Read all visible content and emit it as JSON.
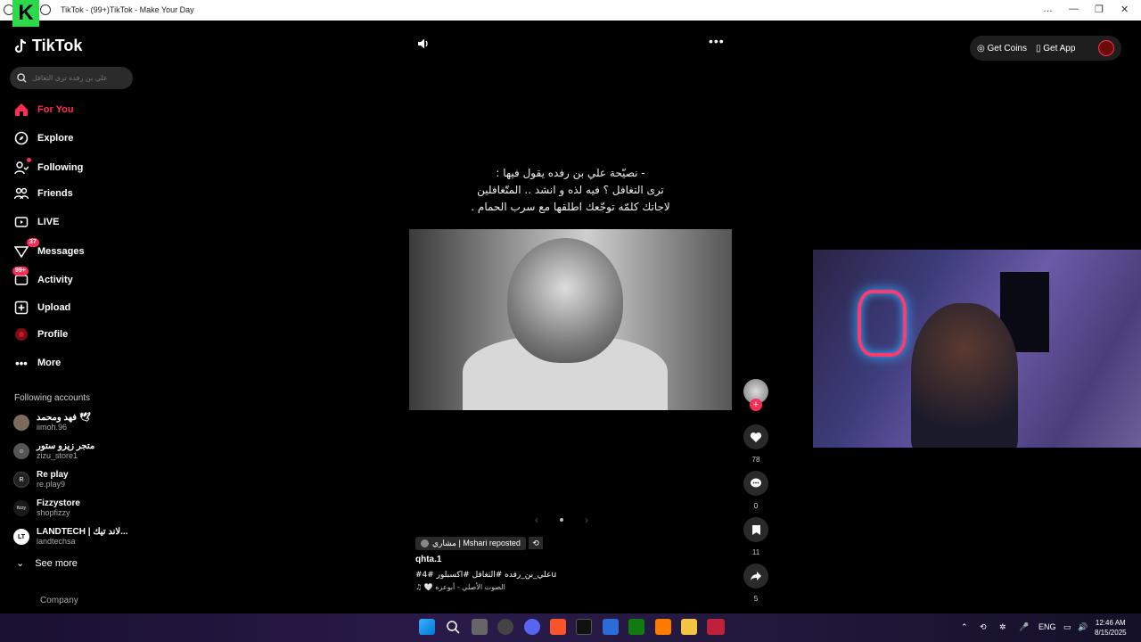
{
  "window": {
    "title": "TikTok - (99+)TikTok - Make Your Day",
    "controls": [
      "…",
      "—",
      "❐",
      "✕"
    ]
  },
  "sidebar": {
    "brand": "TikTok",
    "search_placeholder": "علي بن رفده ترى التغافل",
    "nav": [
      {
        "label": "For You",
        "icon": "home-icon",
        "active": true
      },
      {
        "label": "Explore",
        "icon": "compass-icon"
      },
      {
        "label": "Following",
        "icon": "following-icon"
      },
      {
        "label": "Friends",
        "icon": "friends-icon"
      },
      {
        "label": "LIVE",
        "icon": "live-icon"
      },
      {
        "label": "Messages",
        "icon": "messages-icon",
        "badge": "37"
      },
      {
        "label": "Activity",
        "icon": "activity-icon",
        "badge": "99+"
      },
      {
        "label": "Upload",
        "icon": "upload-icon"
      },
      {
        "label": "Profile",
        "icon": "profile-icon"
      },
      {
        "label": "More",
        "icon": "more-icon"
      }
    ],
    "following_title": "Following accounts",
    "accounts": [
      {
        "name": "فهد ومحمد 🕊",
        "handle": "iimoh.96",
        "initial": ""
      },
      {
        "name": "متجر زيزو ستور",
        "handle": "zizu_store1",
        "initial": "☺"
      },
      {
        "name": "Re play",
        "handle": "re.play9",
        "initial": "R"
      },
      {
        "name": "Fizzystore",
        "handle": "shopfizzy",
        "initial": "fizzy"
      },
      {
        "name": "LANDTECH | لاند تيك...",
        "handle": "landtechsa",
        "initial": "LT"
      }
    ],
    "see_more": "See more",
    "company": "Company"
  },
  "video": {
    "caption_lines": [
      "- نصيّحة علي بن رفده يقول فيها :",
      "ترى التغافل ؟ فيه لذه و انشد .. المتّغافلين",
      "لاجاتك كلمّه توجّعك اطلقها مع سرب الحمام ."
    ],
    "repost_text": "مشاري | Mshari reposted",
    "author": "qhta.1",
    "tags": "#علي_بن_رفده #التغافل #اكسبلور #4u",
    "music": "🤍 الصوت الأصلي - أبوعزه"
  },
  "actions": {
    "likes": "78",
    "comments": "0",
    "saves": "11",
    "shares": "5"
  },
  "topright": {
    "get_coins": "Get Coins",
    "get_app": "Get App"
  },
  "taskbar": {
    "lang": "ENG",
    "time": "12:46 AM",
    "date": "8/15/2025"
  },
  "colors": {
    "accent": "#fe2c55",
    "background": "#000000"
  }
}
